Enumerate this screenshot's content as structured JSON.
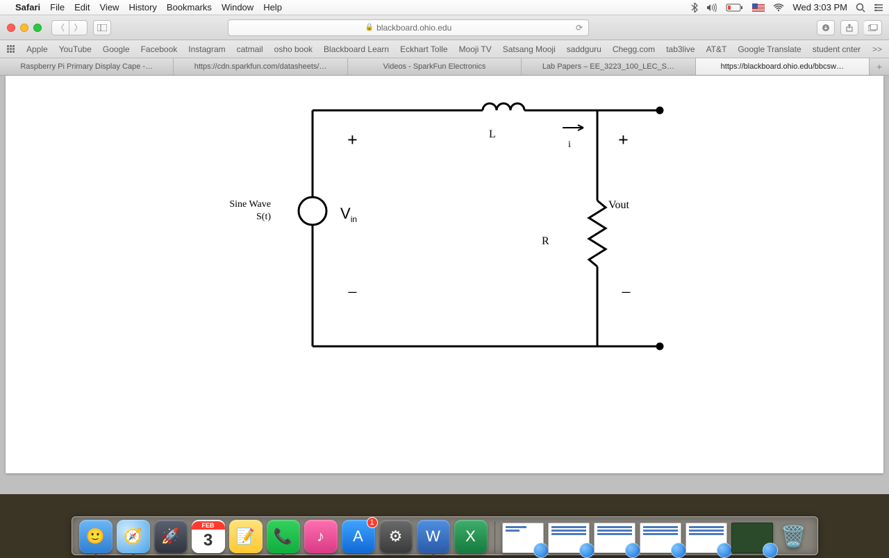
{
  "menubar": {
    "app": "Safari",
    "items": [
      "File",
      "Edit",
      "View",
      "History",
      "Bookmarks",
      "Window",
      "Help"
    ],
    "clock": "Wed 3:03 PM"
  },
  "toolbar": {
    "url": "blackboard.ohio.edu"
  },
  "favorites": [
    "Apple",
    "YouTube",
    "Google",
    "Facebook",
    "Instagram",
    "catmail",
    "osho book",
    "Blackboard Learn",
    "Eckhart Tolle",
    "Mooji TV",
    "Satsang Mooji",
    "saddguru",
    "Chegg.com",
    "tab3live",
    "AT&T",
    "Google Translate",
    "student cnter"
  ],
  "favmore": ">>",
  "tabs": [
    {
      "label": "Raspberry Pi Primary Display Cape -…",
      "active": false
    },
    {
      "label": "https://cdn.sparkfun.com/datasheets/…",
      "active": false
    },
    {
      "label": "Videos - SparkFun Electronics",
      "active": false
    },
    {
      "label": "Lab Papers – EE_3223_100_LEC_S…",
      "active": false
    },
    {
      "label": "https://blackboard.ohio.edu/bbcsw…",
      "active": true
    }
  ],
  "circuit": {
    "source1": "Sine Wave",
    "source2": "S(t)",
    "vin": "V",
    "vin_sub": "in",
    "L": "L",
    "i": "i",
    "R": "R",
    "vout": "Vout",
    "plus": "+",
    "minus": "−"
  },
  "dock": {
    "cal_month": "FEB",
    "cal_day": "3",
    "appstore_badge": "1"
  }
}
